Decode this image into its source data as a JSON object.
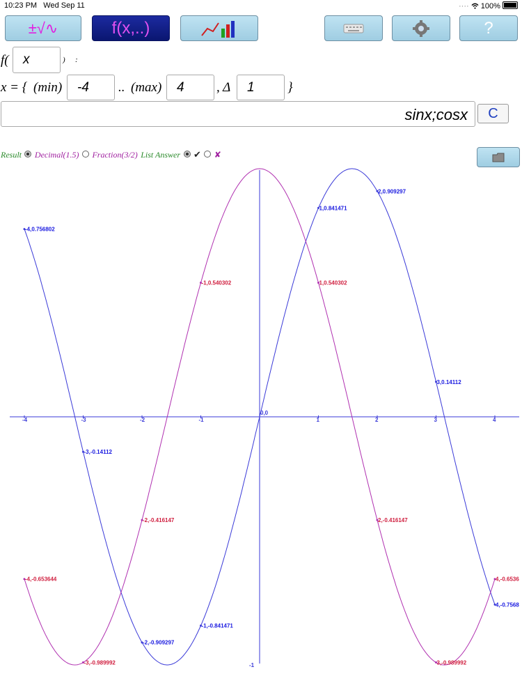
{
  "status_bar": {
    "time": "10:23 PM",
    "date": "Wed Sep 11",
    "battery": "100%"
  },
  "toolbar": {
    "calc_label": "±√∿",
    "function_label": "f(x,..)",
    "keyboard_icon": "keyboard-icon",
    "settings_icon": "gear-icon",
    "help_label": "?"
  },
  "function_row": {
    "prefix": "f(",
    "variable": "x",
    "suffix": ")",
    "colon": ":"
  },
  "range_row": {
    "prefix": "x = {",
    "min_label": "(min)",
    "min_value": "-4",
    "sep": "..",
    "max_label": "(max)",
    "max_value": "4",
    "delta_label": ", Δ",
    "delta_value": "1",
    "close": "}"
  },
  "expression": {
    "value": "sinx;cosx",
    "clear_label": "C"
  },
  "options": {
    "result_label": "Result",
    "decimal_label": "Decimal(1.5)",
    "fraction_label": "Fraction(3/2)",
    "list_answer_label": "List Answer",
    "check_symbol": "✔",
    "cross_symbol": "✘",
    "colors": {
      "result": "#2a8a2a",
      "options": "#a020a0"
    }
  },
  "chart_data": {
    "type": "line",
    "x_ticks": [
      "-4",
      "-3",
      "-2",
      "-1",
      "1",
      "2",
      "3",
      "4"
    ],
    "y_ticks": [
      "-1"
    ],
    "origin_label": "0,0",
    "xlim": [
      -4,
      4
    ],
    "ylim": [
      -1,
      1
    ],
    "series": [
      {
        "color": "#3a3ad8",
        "points": [
          {
            "x": -4,
            "y": 0.756802,
            "label": "-4,0.756802"
          },
          {
            "x": -3,
            "y": -0.14112,
            "label": "-3,-0.14112"
          },
          {
            "x": -2,
            "y": -0.909297,
            "label": "-2,-0.909297"
          },
          {
            "x": -1,
            "y": -0.841471,
            "label": "-1,-0.841471"
          },
          {
            "x": 1,
            "y": 0.841471,
            "label": "1,0.841471"
          },
          {
            "x": 2,
            "y": 0.909297,
            "label": "2,0.909297"
          },
          {
            "x": 3,
            "y": 0.14112,
            "label": "3,0.14112"
          },
          {
            "x": 4,
            "y": -0.756802,
            "label": "4,-0.7568"
          }
        ]
      },
      {
        "color": "#b030b0",
        "points": [
          {
            "x": -4,
            "y": -0.653644,
            "label": "-4,-0.653644"
          },
          {
            "x": -3,
            "y": -0.989992,
            "label": "-3,-0.989992"
          },
          {
            "x": -2,
            "y": -0.416147,
            "label": "-2,-0.416147"
          },
          {
            "x": -1,
            "y": 0.540302,
            "label": "-1,0.540302"
          },
          {
            "x": 1,
            "y": 0.540302,
            "label": "1,0.540302"
          },
          {
            "x": 2,
            "y": -0.416147,
            "label": "2,-0.416147"
          },
          {
            "x": 3,
            "y": -0.989992,
            "label": "3,-0.989992"
          },
          {
            "x": 4,
            "y": -0.653644,
            "label": "4,-0.6536"
          }
        ]
      }
    ]
  }
}
